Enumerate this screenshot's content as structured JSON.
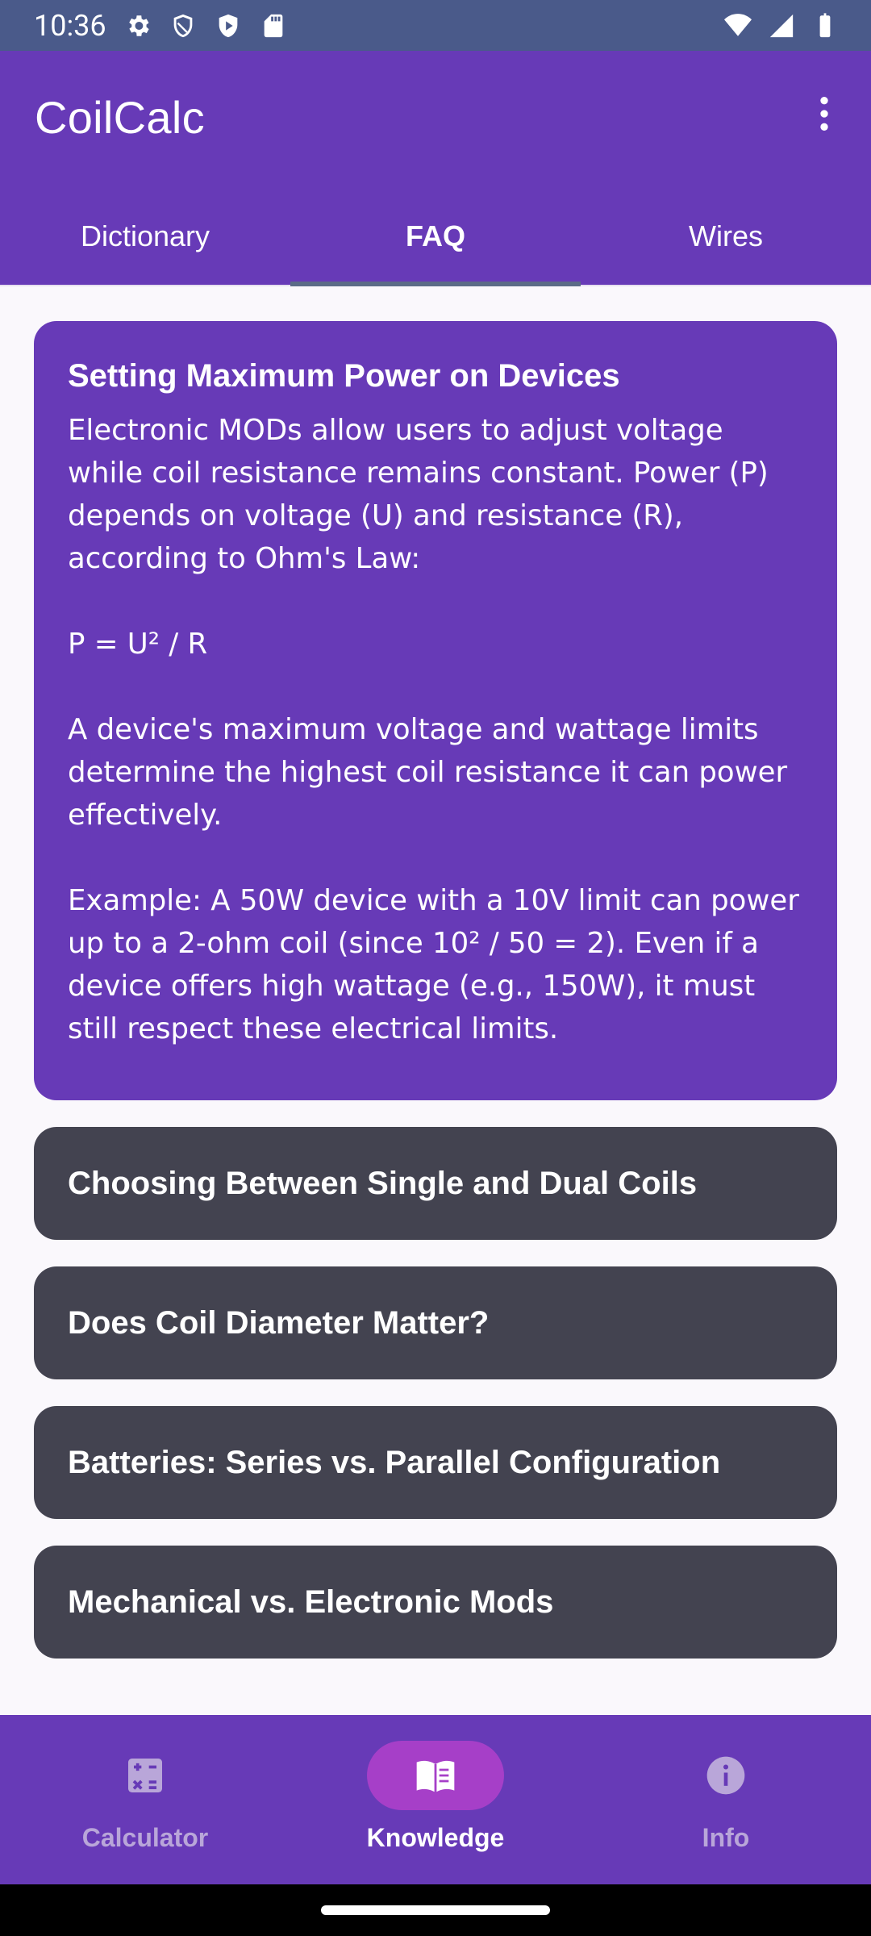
{
  "status_bar": {
    "time": "10:36",
    "icons_left": [
      "gear-icon",
      "shield-icon",
      "play-shield-icon",
      "sd-card-icon"
    ],
    "icons_right": [
      "wifi-icon",
      "signal-icon",
      "battery-icon"
    ]
  },
  "app_bar": {
    "title": "CoilCalc",
    "overflow_icon": "more-vertical-icon"
  },
  "tabs": [
    {
      "label": "Dictionary",
      "active": false
    },
    {
      "label": "FAQ",
      "active": true
    },
    {
      "label": "Wires",
      "active": false
    }
  ],
  "faq": [
    {
      "title": "Setting Maximum Power on Devices",
      "expanded": true,
      "body": "Electronic MODs allow users to adjust voltage while coil resistance remains constant. Power (P) depends on voltage (U) and resistance (R), according to Ohm's Law:\n\nP = U² / R\n\nA device's maximum voltage and wattage limits determine the highest coil resistance it can power effectively.\n\nExample: A 50W device with a 10V limit can power up to a 2-ohm coil (since 10² / 50 = 2). Even if a device offers high wattage (e.g., 150W), it must still respect these electrical limits."
    },
    {
      "title": "Choosing Between Single and Dual Coils",
      "expanded": false
    },
    {
      "title": "Does Coil Diameter Matter?",
      "expanded": false
    },
    {
      "title": "Batteries: Series vs. Parallel Configuration",
      "expanded": false
    },
    {
      "title": "Mechanical vs. Electronic Mods",
      "expanded": false
    }
  ],
  "bottom_nav": [
    {
      "label": "Calculator",
      "icon": "calculator-icon",
      "active": false
    },
    {
      "label": "Knowledge",
      "icon": "book-icon",
      "active": true
    },
    {
      "label": "Info",
      "icon": "info-icon",
      "active": false
    }
  ],
  "colors": {
    "primary": "#673ab7",
    "status_bar": "#4a5a8a",
    "card_collapsed": "#434350",
    "nav_active_pill": "#a63fc8"
  }
}
